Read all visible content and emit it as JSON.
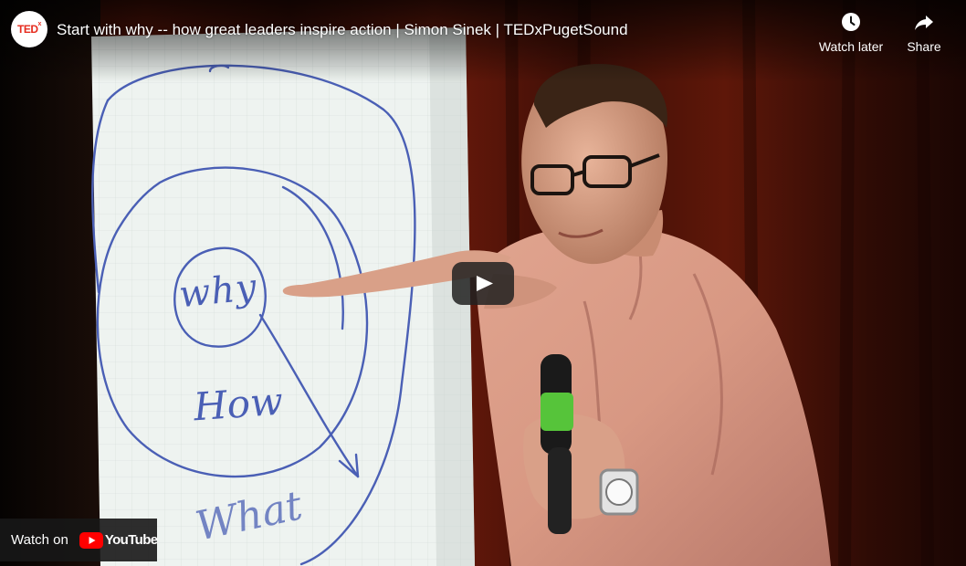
{
  "video": {
    "title": "Start with why -- how great leaders inspire action | Simon Sinek | TEDxPugetSound",
    "channel_logo_text": "TED",
    "channel_logo_sup": "x"
  },
  "actions": {
    "watch_later_label": "Watch later",
    "share_label": "Share"
  },
  "watch_on": {
    "label": "Watch on",
    "brand": "YouTube"
  },
  "flipchart_text": {
    "inner": "why",
    "middle": "How",
    "outer": "What"
  },
  "colors": {
    "youtube_red": "#ff0000",
    "ted_red": "#e62b1e",
    "play_button_bg": "#212121",
    "marker_blue": "#4a5fb5"
  },
  "icons": {
    "watch_later": "clock-icon",
    "share": "share-arrow-icon",
    "play": "play-icon",
    "youtube": "youtube-logo-icon"
  }
}
